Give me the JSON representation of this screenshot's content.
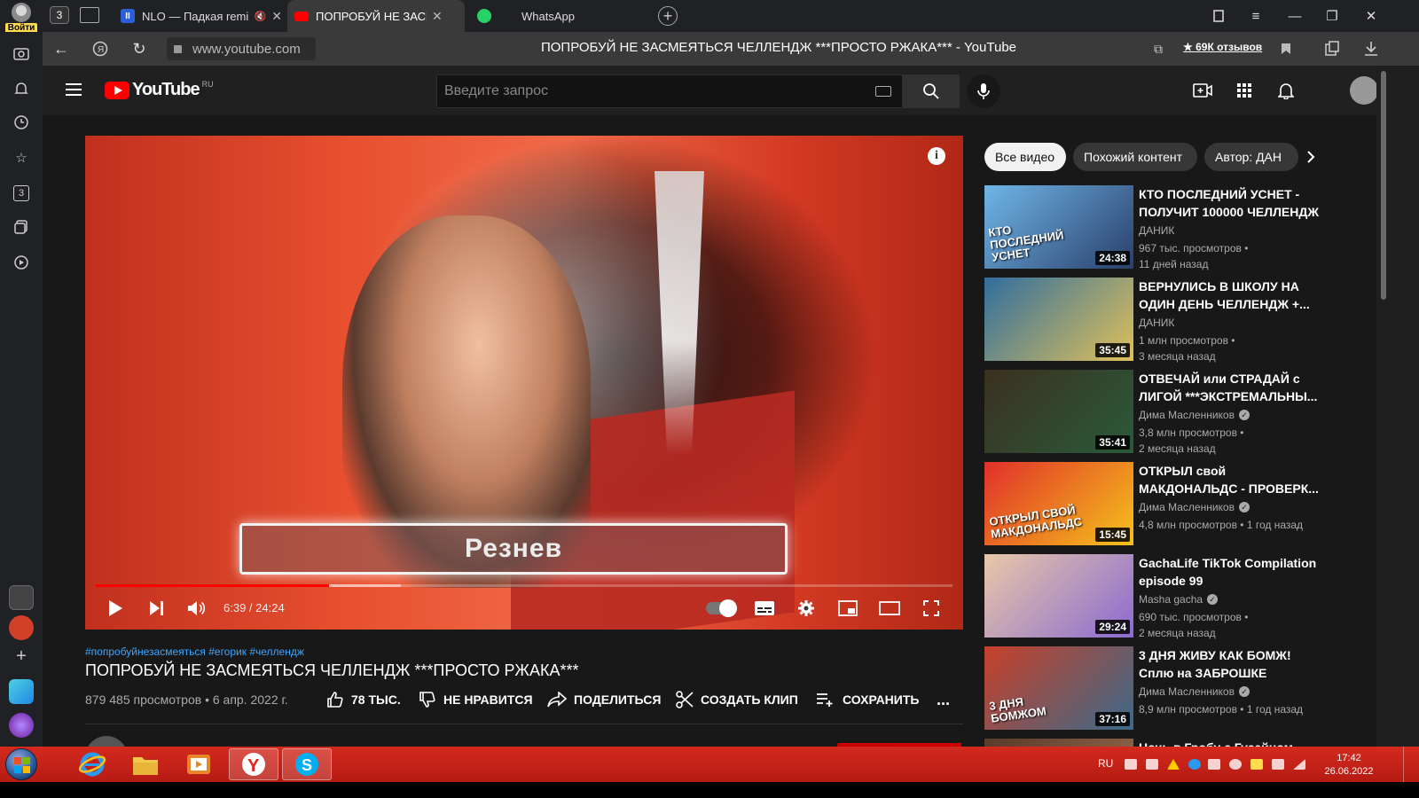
{
  "browser": {
    "profile_label": "Войти",
    "tab_count": "3",
    "tabs": [
      {
        "title": "NLO — Падкая remi",
        "muted": "🔇"
      },
      {
        "title": "ПОПРОБУЙ НЕ ЗАСМЕ"
      },
      {
        "title": "WhatsApp"
      }
    ],
    "url": "www.youtube.com",
    "page_title": "ПОПРОБУЙ НЕ ЗАСМЕЯТЬСЯ ЧЕЛЛЕНДЖ ***ПРОСТО РЖАКА*** - YouTube",
    "reviews_label": "★ 69К отзывов",
    "sidebar_badge": "3"
  },
  "youtube": {
    "logo_text": "YouTube",
    "logo_region": "RU",
    "search_placeholder": "Введите запрос",
    "player": {
      "overlay_text": "Резнев",
      "time": "6:39 / 24:24",
      "played_fraction": 0.272,
      "buffered_fraction": 0.356
    },
    "video": {
      "hashtags": "#попробуйнезасмеяться #егорик #челлендж",
      "title": "ПОПРОБУЙ НЕ ЗАСМЕЯТЬСЯ ЧЕЛЛЕНДЖ ***ПРОСТО РЖАКА***",
      "stats": "879 485 просмотров • 6 апр. 2022 г.",
      "likes": "78 ТЫС.",
      "dislike": "НЕ НРАВИТСЯ",
      "share": "ПОДЕЛИТЬСЯ",
      "clip": "СОЗДАТЬ КЛИП",
      "save": "СОХРАНИТЬ",
      "more": "..."
    },
    "chips": [
      "Все видео",
      "Похожий контент",
      "Автор: ДАН"
    ],
    "recommendations": [
      {
        "title": "КТО ПОСЛЕДНИЙ УСНЕТ - ПОЛУЧИТ 100000 ЧЕЛЛЕНДЖ",
        "channel": "ДАНИК",
        "verified": false,
        "views": "967 тыс. просмотров •",
        "age": "11 дней назад",
        "duration": "24:38",
        "thumb_text": "КТО ПОСЛЕДНИЙ УСНЕТ",
        "colors": [
          "#6fb6e8",
          "#2a3f6a"
        ]
      },
      {
        "title": "ВЕРНУЛИСЬ В ШКОЛУ НА ОДИН ДЕНЬ ЧЕЛЛЕНДЖ +...",
        "channel": "ДАНИК",
        "verified": false,
        "views": "1 млн просмотров •",
        "age": "3 месяца назад",
        "duration": "35:45",
        "thumb_text": "",
        "colors": [
          "#2f6e9e",
          "#e0c05a"
        ]
      },
      {
        "title": "ОТВЕЧАЙ или СТРАДАЙ с ЛИГОЙ ***ЭКСТРЕМАЛЬНЫ...",
        "channel": "Дима Масленников",
        "verified": true,
        "views": "3,8 млн просмотров •",
        "age": "2 месяца назад",
        "duration": "35:41",
        "thumb_text": "",
        "colors": [
          "#3a3020",
          "#2b5a3a"
        ]
      },
      {
        "title": "ОТКРЫЛ свой МАКДОНАЛЬДС - ПРОВЕРК...",
        "channel": "Дима Масленников",
        "verified": true,
        "views": "4,8 млн просмотров • 1 год назад",
        "age": "",
        "duration": "15:45",
        "thumb_text": "ОТКРЫЛ СВОЙ МАКДОНАЛЬДС",
        "colors": [
          "#e0302a",
          "#f5c21c"
        ]
      },
      {
        "title": "GachaLife TikTok Compilation episode 99",
        "channel": "Masha gacha",
        "verified": true,
        "views": "690 тыс. просмотров •",
        "age": "2 месяца назад",
        "duration": "29:24",
        "thumb_text": "",
        "colors": [
          "#e8c8a8",
          "#8a6ad0"
        ]
      },
      {
        "title": "3 ДНЯ ЖИВУ КАК БОМЖ! Сплю на ЗАБРОШКЕ",
        "channel": "Дима Масленников",
        "verified": true,
        "views": "8,9 млн просмотров • 1 год назад",
        "age": "",
        "duration": "37:16",
        "thumb_text": "3 ДНЯ БОМЖОМ",
        "colors": [
          "#c8402a",
          "#3a6a8a"
        ]
      },
      {
        "title": "Ночь в Гробу с Гусейном",
        "channel": "",
        "verified": false,
        "views": "",
        "age": "",
        "duration": "",
        "thumb_text": "",
        "colors": [
          "#5a3a2a",
          "#a07050"
        ]
      }
    ]
  },
  "taskbar": {
    "lang": "RU",
    "time": "17:42",
    "date": "26.06.2022"
  }
}
